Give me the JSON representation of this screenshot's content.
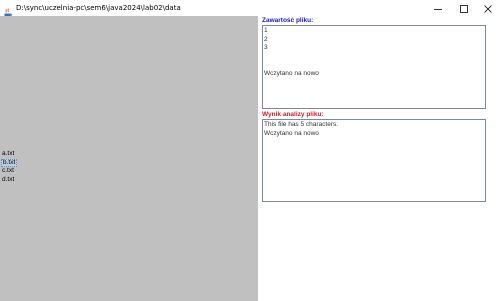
{
  "window": {
    "title": "D:\\sync\\uczelnia-pc\\sem6\\java2024\\lab02\\data",
    "icons": [
      "java-app-icon",
      "minimize-icon",
      "maximize-icon",
      "close-icon"
    ]
  },
  "file_list": {
    "items": [
      {
        "label": "a.txt",
        "selected": false
      },
      {
        "label": "b.txt",
        "selected": true
      },
      {
        "label": "c.txt",
        "selected": false
      },
      {
        "label": "d.txt",
        "selected": false
      }
    ]
  },
  "content_panel": {
    "label": "Zawartość pliku:",
    "lines": [
      "1",
      "2",
      "3",
      "",
      "",
      "Wczytano na nowo"
    ]
  },
  "analysis_panel": {
    "label": "Wynik analizy pliku:",
    "lines": [
      "This file has 5 characters.",
      "Wczytano na nowo"
    ]
  },
  "colors": {
    "left_panel_bg": "#c0c0c0",
    "content_label": "#1a1aa6",
    "analysis_label": "#d0202a",
    "selection_bg": "#b8cfe5"
  }
}
